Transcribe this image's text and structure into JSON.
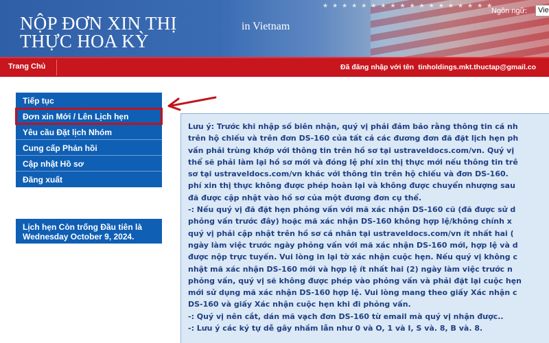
{
  "header": {
    "title_line1": "NỘP ĐƠN XIN THỊ",
    "title_line2": "THỰC HOA KỲ",
    "country": "in Vietnam",
    "language_label": "Ngôn ngữ:",
    "language_value": "Viet"
  },
  "navbar": {
    "home": "Trang Chủ",
    "login_prefix": "Đã đăng nhập với tên",
    "login_user": "tinholdings.mkt.thuctap@gmail.co"
  },
  "menu": {
    "items": [
      {
        "label": "Tiếp tục"
      },
      {
        "label": "Đơn xin Mới / Lên Lịch hẹn",
        "highlighted": true
      },
      {
        "label": "Yêu cầu Đặt lịch Nhóm"
      },
      {
        "label": "Cung cấp Phản hồi"
      },
      {
        "label": "Cập nhật Hồ sơ"
      },
      {
        "label": "Đăng xuất"
      }
    ]
  },
  "appointment": {
    "line1": "Lịch hẹn Còn trống Đầu tiên là",
    "line2": "Wednesday October 9, 2024."
  },
  "notice": {
    "lines": [
      "Lưu ý: Trước khi nhập số biên nhận, quý vị phải đảm bảo rằng thông tin cá nh",
      "trên hộ chiếu và trên đơn DS-160 của tất cả các đương đơn đã đặt lịch hẹn ph",
      "vấn phải trùng khớp với thông tin trên hồ sơ tại ustraveldocs.com/vn. Quý vị",
      "thể sẽ phải làm lại hồ sơ mới và đóng lệ phí xin thị thực mới nếu thông tin trê",
      "sơ tại ustraveldocs.com/vn khác với thông tin trên hộ chiếu và đơn DS-160.",
      "phí xin thị thực không được phép hoàn lại và không được chuyển nhượng sau",
      "đã được cập nhật vào hồ sơ của một đương đơn cụ thể.",
      "-: Nếu quý vị đã đặt hẹn phỏng vấn với mã xác nhận DS-160 cũ (đã được sử d",
      "phỏng vấn trước đây) hoặc mã xác nhận DS-160 không hợp lệ/không chính x",
      "quý vị phải cập nhật trên hồ sơ cá nhân tại ustraveldocs.com/vn ít nhất hai (",
      "ngày làm việc trước ngày phỏng vấn với mã xác nhận DS-160 mới, hợp lệ và d",
      "được nộp trực tuyến. Vui lòng in lại tờ xác nhận cuộc hẹn. Nếu quý vị không c",
      "nhật mã xác nhận DS-160 mới và hợp lệ ít nhất hai (2) ngày làm việc trước n",
      "phỏng vấn, quý vị sẽ không được phép vào phỏng vấn và phải đặt lại cuộc hẹn",
      "mới sử dụng mã xác nhận DS-160 hợp lệ. Vui lòng mang theo giấy Xác nhận c",
      "DS-160 và giấy Xác nhận cuộc hẹn khi đi phỏng vấn.",
      "-: Quý vị nên cắt, dán mã vạch đơn DS-160 từ email mà quý vị nhận được..",
      "-: Lưu ý các ký tự dễ gây nhầm lẫn như 0 và O, 1 và I, S và. 8, B và. 8."
    ]
  },
  "colors": {
    "nav_red": "#c7161e",
    "menu_blue": "#0f5fb4",
    "notice_bg": "#dbe8f6",
    "notice_text": "#1f3f82",
    "annotation_red": "#c1121c"
  },
  "icons": {
    "annotation": "red-arrow-icon"
  }
}
